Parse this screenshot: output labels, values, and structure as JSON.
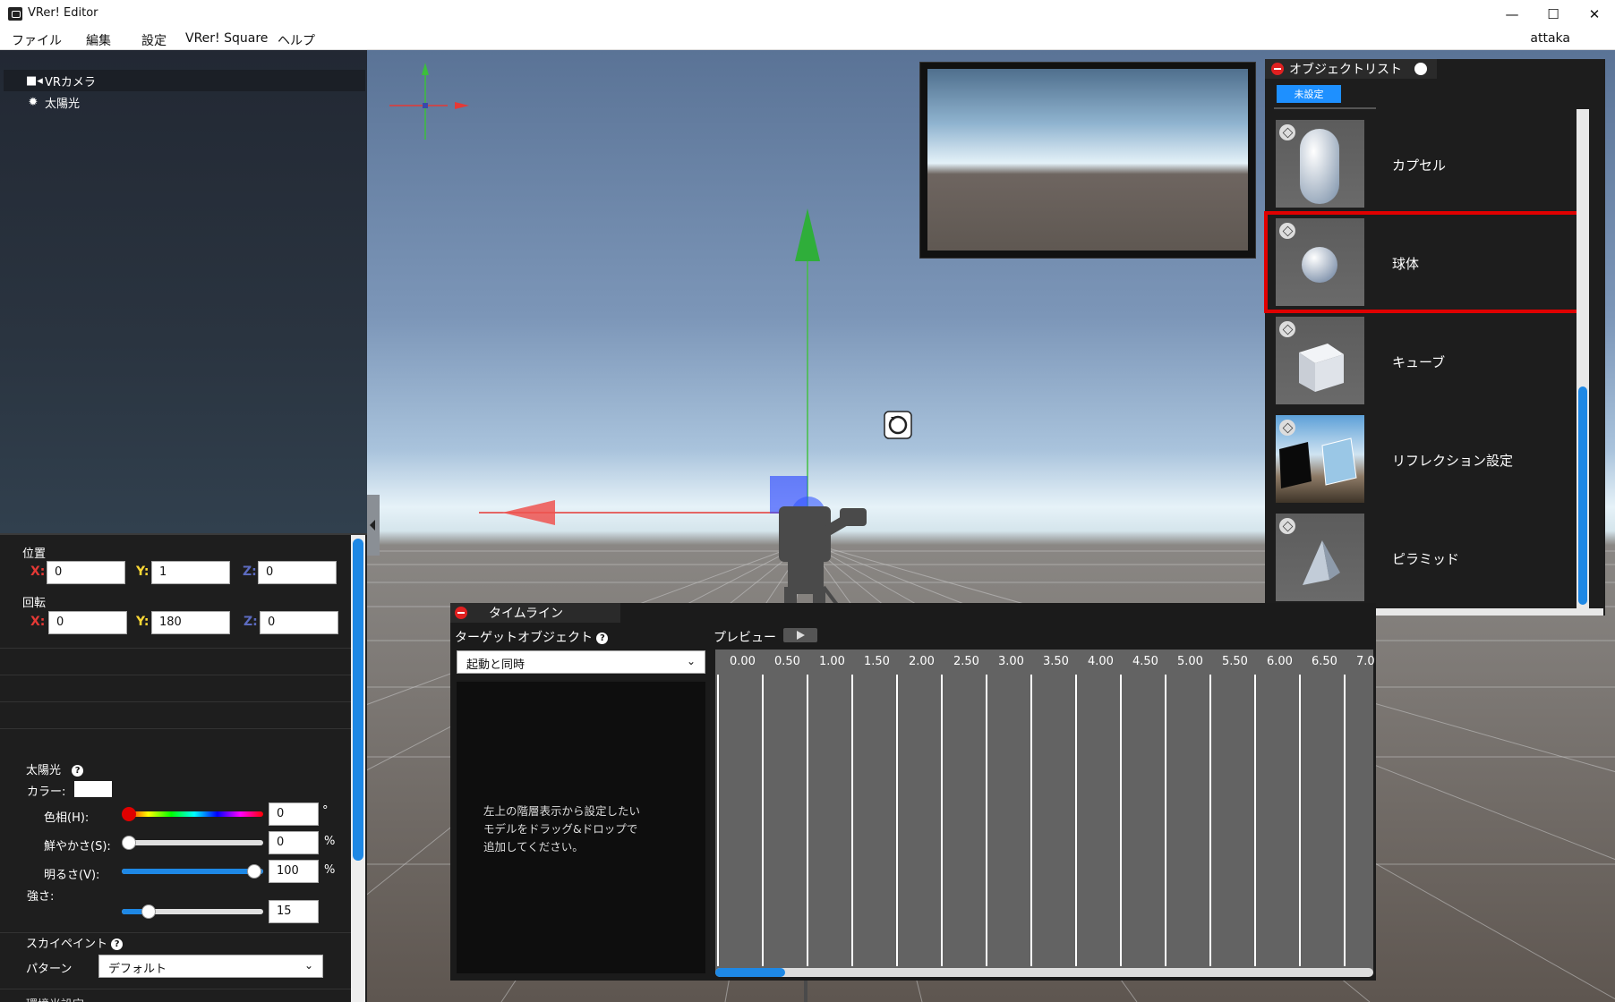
{
  "window": {
    "title": "VRer! Editor",
    "minimize": "—",
    "maximize": "☐",
    "close": "✕"
  },
  "menu": {
    "items": [
      "ファイル",
      "編集",
      "設定",
      "VRer! Square",
      "ヘルプ"
    ],
    "user": "attaka"
  },
  "hierarchy": {
    "items": [
      {
        "label": "VRカメラ",
        "icon": "video-camera-icon",
        "selected": true
      },
      {
        "label": "太陽光",
        "icon": "sun-icon",
        "selected": false
      }
    ]
  },
  "inspector": {
    "position": {
      "label": "位置",
      "x_label": "X:",
      "y_label": "Y:",
      "z_label": "Z:",
      "x": "0",
      "y": "1",
      "z": "0"
    },
    "rotation": {
      "label": "回転",
      "x_label": "X:",
      "y_label": "Y:",
      "z_label": "Z:",
      "x": "0",
      "y": "180",
      "z": "0"
    },
    "sunlight": {
      "title": "太陽光",
      "help": "?",
      "color_label": "カラー:",
      "color": "#ffffff",
      "hue_label": "色相(H):",
      "hue_value": "0",
      "hue_unit": "°",
      "saturation_label": "鮮やかさ(S):",
      "saturation_value": "0",
      "saturation_unit": "%",
      "brightness_label": "明るさ(V):",
      "brightness_value": "100",
      "brightness_unit": "%",
      "intensity_label": "強さ:",
      "intensity_value": "15"
    },
    "skypaint": {
      "title": "スカイペイント",
      "help": "?",
      "pattern_label": "パターン",
      "pattern_value": "デフォルト"
    },
    "cut_off_label": "環境光設定"
  },
  "object_list": {
    "title": "オブジェクトリスト",
    "filter_chip": "未設定",
    "items": [
      {
        "name": "カプセル",
        "icon": "cube-icon",
        "shape": "capsule"
      },
      {
        "name": "球体",
        "icon": "cube-icon",
        "shape": "sphere",
        "highlighted": true
      },
      {
        "name": "キューブ",
        "icon": "cube-icon",
        "shape": "cube"
      },
      {
        "name": "リフレクション設定",
        "icon": "cube-icon",
        "shape": "reflection"
      },
      {
        "name": "ピラミッド",
        "icon": "cube-icon",
        "shape": "pyramid"
      }
    ]
  },
  "timeline": {
    "title": "タイムライン",
    "target_label": "ターゲットオブジェクト",
    "help": "?",
    "preview_label": "プレビュー",
    "trigger_value": "起動と同時",
    "drop_hint": "左上の階層表示から設定したい\nモデルをドラッグ&ドロップで\n追加してください。",
    "ticks": [
      "0.00",
      "0.50",
      "1.00",
      "1.50",
      "2.00",
      "2.50",
      "3.00",
      "3.50",
      "4.00",
      "4.50",
      "5.00",
      "5.50",
      "6.00",
      "6.50",
      "7.0"
    ]
  },
  "colors": {
    "accent": "#1e88e5",
    "highlight": "#e00000",
    "axis_x": "#e53935",
    "axis_y": "#43a047",
    "axis_z": "#5c6bc0",
    "close_dot": "#e02020"
  }
}
